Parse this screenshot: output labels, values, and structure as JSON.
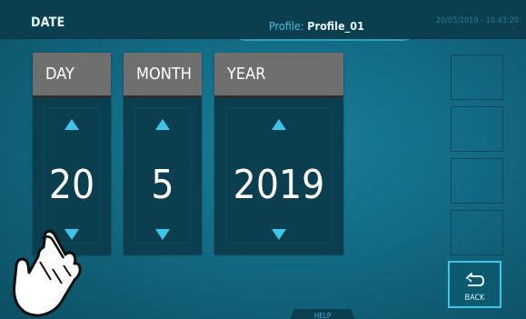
{
  "header": {
    "title": "DATE",
    "profile_label": "Profile:",
    "profile_name": "Profile_01",
    "datetime": "20/05/2019 - 10:43:20"
  },
  "panels": [
    {
      "label": "DAY",
      "value": "20"
    },
    {
      "label": "MONTH",
      "value": "5"
    },
    {
      "label": "YEAR",
      "value": "2019"
    }
  ],
  "side_buttons": {
    "back_label": "BACK"
  },
  "footer": {
    "help_label": "HELP"
  },
  "colors": {
    "accent": "#3cc7ea",
    "panel": "#0b3e4f",
    "header": "#6f6f6f",
    "background": "#136b84"
  },
  "icons": [
    "up-arrow-icon",
    "down-arrow-icon",
    "back-icon",
    "pointer-hand-icon"
  ]
}
